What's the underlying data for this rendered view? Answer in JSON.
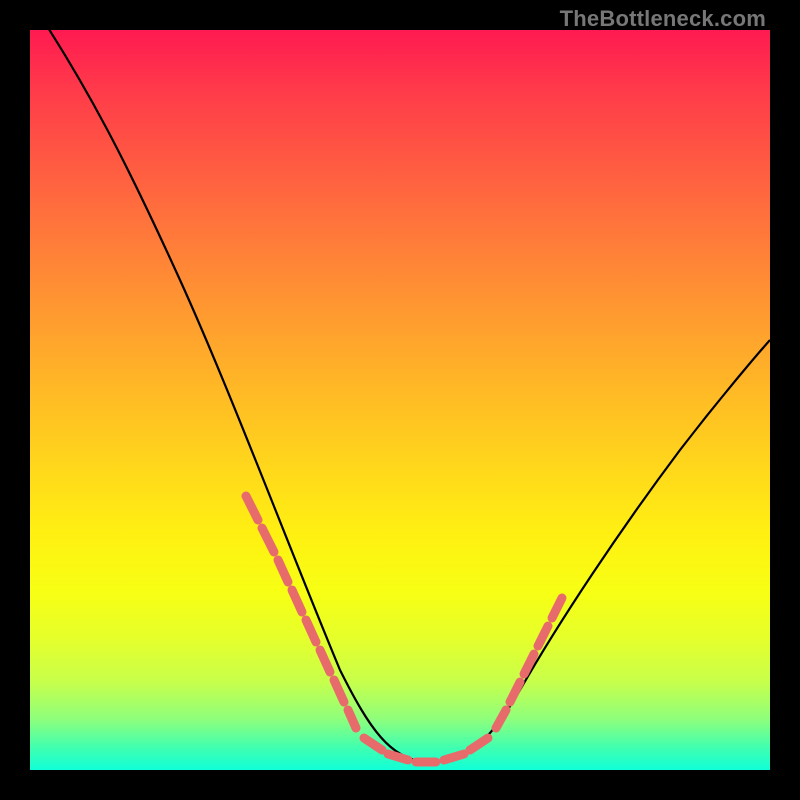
{
  "watermark": "TheBottleneck.com",
  "colors": {
    "background": "#000000",
    "curve": "#000000",
    "marker": "#e86b6b",
    "gradient_top": "#ff1a51",
    "gradient_bottom": "#10ffd8"
  },
  "chart_data": {
    "type": "line",
    "title": "",
    "xlabel": "",
    "ylabel": "",
    "xlim": [
      0,
      100
    ],
    "ylim": [
      0,
      100
    ],
    "series": [
      {
        "name": "bottleneck-curve",
        "x": [
          0,
          5,
          10,
          15,
          20,
          25,
          30,
          35,
          40,
          43,
          46,
          49,
          52,
          55,
          58,
          62,
          66,
          70,
          75,
          80,
          85,
          90,
          95,
          100
        ],
        "values": [
          104,
          94,
          83,
          72,
          60,
          48,
          37,
          26,
          15,
          9,
          5,
          2,
          1,
          1,
          2,
          5,
          10,
          16,
          23,
          30,
          37,
          44,
          51,
          58
        ]
      }
    ],
    "markers": [
      {
        "name": "cluster-left",
        "x_range": [
          30,
          43
        ],
        "y_range": [
          9,
          37
        ]
      },
      {
        "name": "cluster-floor",
        "x_range": [
          43,
          58
        ],
        "y_range": [
          1,
          5
        ]
      },
      {
        "name": "cluster-right",
        "x_range": [
          58,
          70
        ],
        "y_range": [
          5,
          16
        ]
      }
    ],
    "annotations": []
  }
}
